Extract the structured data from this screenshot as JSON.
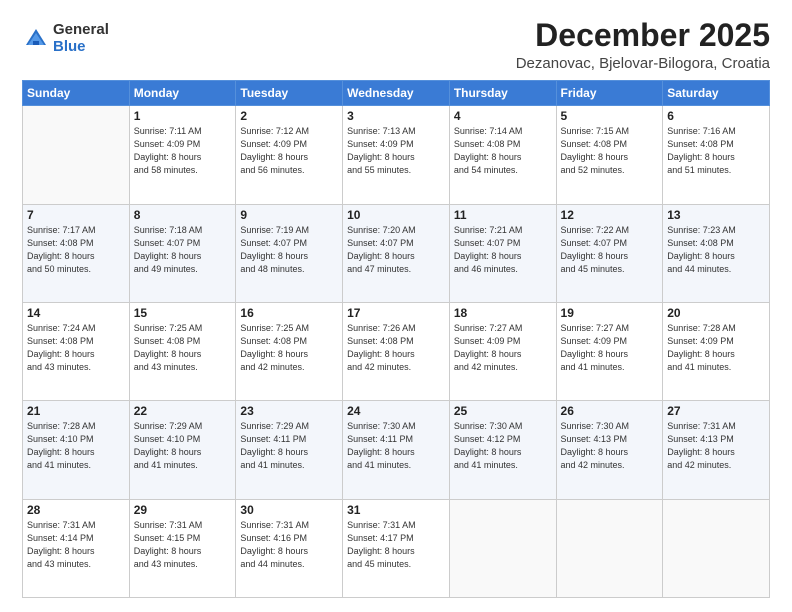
{
  "logo": {
    "general": "General",
    "blue": "Blue"
  },
  "title": "December 2025",
  "subtitle": "Dezanovac, Bjelovar-Bilogora, Croatia",
  "days_of_week": [
    "Sunday",
    "Monday",
    "Tuesday",
    "Wednesday",
    "Thursday",
    "Friday",
    "Saturday"
  ],
  "weeks": [
    [
      {
        "day": "",
        "info": ""
      },
      {
        "day": "1",
        "info": "Sunrise: 7:11 AM\nSunset: 4:09 PM\nDaylight: 8 hours\nand 58 minutes."
      },
      {
        "day": "2",
        "info": "Sunrise: 7:12 AM\nSunset: 4:09 PM\nDaylight: 8 hours\nand 56 minutes."
      },
      {
        "day": "3",
        "info": "Sunrise: 7:13 AM\nSunset: 4:09 PM\nDaylight: 8 hours\nand 55 minutes."
      },
      {
        "day": "4",
        "info": "Sunrise: 7:14 AM\nSunset: 4:08 PM\nDaylight: 8 hours\nand 54 minutes."
      },
      {
        "day": "5",
        "info": "Sunrise: 7:15 AM\nSunset: 4:08 PM\nDaylight: 8 hours\nand 52 minutes."
      },
      {
        "day": "6",
        "info": "Sunrise: 7:16 AM\nSunset: 4:08 PM\nDaylight: 8 hours\nand 51 minutes."
      }
    ],
    [
      {
        "day": "7",
        "info": "Sunrise: 7:17 AM\nSunset: 4:08 PM\nDaylight: 8 hours\nand 50 minutes."
      },
      {
        "day": "8",
        "info": "Sunrise: 7:18 AM\nSunset: 4:07 PM\nDaylight: 8 hours\nand 49 minutes."
      },
      {
        "day": "9",
        "info": "Sunrise: 7:19 AM\nSunset: 4:07 PM\nDaylight: 8 hours\nand 48 minutes."
      },
      {
        "day": "10",
        "info": "Sunrise: 7:20 AM\nSunset: 4:07 PM\nDaylight: 8 hours\nand 47 minutes."
      },
      {
        "day": "11",
        "info": "Sunrise: 7:21 AM\nSunset: 4:07 PM\nDaylight: 8 hours\nand 46 minutes."
      },
      {
        "day": "12",
        "info": "Sunrise: 7:22 AM\nSunset: 4:07 PM\nDaylight: 8 hours\nand 45 minutes."
      },
      {
        "day": "13",
        "info": "Sunrise: 7:23 AM\nSunset: 4:08 PM\nDaylight: 8 hours\nand 44 minutes."
      }
    ],
    [
      {
        "day": "14",
        "info": "Sunrise: 7:24 AM\nSunset: 4:08 PM\nDaylight: 8 hours\nand 43 minutes."
      },
      {
        "day": "15",
        "info": "Sunrise: 7:25 AM\nSunset: 4:08 PM\nDaylight: 8 hours\nand 43 minutes."
      },
      {
        "day": "16",
        "info": "Sunrise: 7:25 AM\nSunset: 4:08 PM\nDaylight: 8 hours\nand 42 minutes."
      },
      {
        "day": "17",
        "info": "Sunrise: 7:26 AM\nSunset: 4:08 PM\nDaylight: 8 hours\nand 42 minutes."
      },
      {
        "day": "18",
        "info": "Sunrise: 7:27 AM\nSunset: 4:09 PM\nDaylight: 8 hours\nand 42 minutes."
      },
      {
        "day": "19",
        "info": "Sunrise: 7:27 AM\nSunset: 4:09 PM\nDaylight: 8 hours\nand 41 minutes."
      },
      {
        "day": "20",
        "info": "Sunrise: 7:28 AM\nSunset: 4:09 PM\nDaylight: 8 hours\nand 41 minutes."
      }
    ],
    [
      {
        "day": "21",
        "info": "Sunrise: 7:28 AM\nSunset: 4:10 PM\nDaylight: 8 hours\nand 41 minutes."
      },
      {
        "day": "22",
        "info": "Sunrise: 7:29 AM\nSunset: 4:10 PM\nDaylight: 8 hours\nand 41 minutes."
      },
      {
        "day": "23",
        "info": "Sunrise: 7:29 AM\nSunset: 4:11 PM\nDaylight: 8 hours\nand 41 minutes."
      },
      {
        "day": "24",
        "info": "Sunrise: 7:30 AM\nSunset: 4:11 PM\nDaylight: 8 hours\nand 41 minutes."
      },
      {
        "day": "25",
        "info": "Sunrise: 7:30 AM\nSunset: 4:12 PM\nDaylight: 8 hours\nand 41 minutes."
      },
      {
        "day": "26",
        "info": "Sunrise: 7:30 AM\nSunset: 4:13 PM\nDaylight: 8 hours\nand 42 minutes."
      },
      {
        "day": "27",
        "info": "Sunrise: 7:31 AM\nSunset: 4:13 PM\nDaylight: 8 hours\nand 42 minutes."
      }
    ],
    [
      {
        "day": "28",
        "info": "Sunrise: 7:31 AM\nSunset: 4:14 PM\nDaylight: 8 hours\nand 43 minutes."
      },
      {
        "day": "29",
        "info": "Sunrise: 7:31 AM\nSunset: 4:15 PM\nDaylight: 8 hours\nand 43 minutes."
      },
      {
        "day": "30",
        "info": "Sunrise: 7:31 AM\nSunset: 4:16 PM\nDaylight: 8 hours\nand 44 minutes."
      },
      {
        "day": "31",
        "info": "Sunrise: 7:31 AM\nSunset: 4:17 PM\nDaylight: 8 hours\nand 45 minutes."
      },
      {
        "day": "",
        "info": ""
      },
      {
        "day": "",
        "info": ""
      },
      {
        "day": "",
        "info": ""
      }
    ]
  ]
}
